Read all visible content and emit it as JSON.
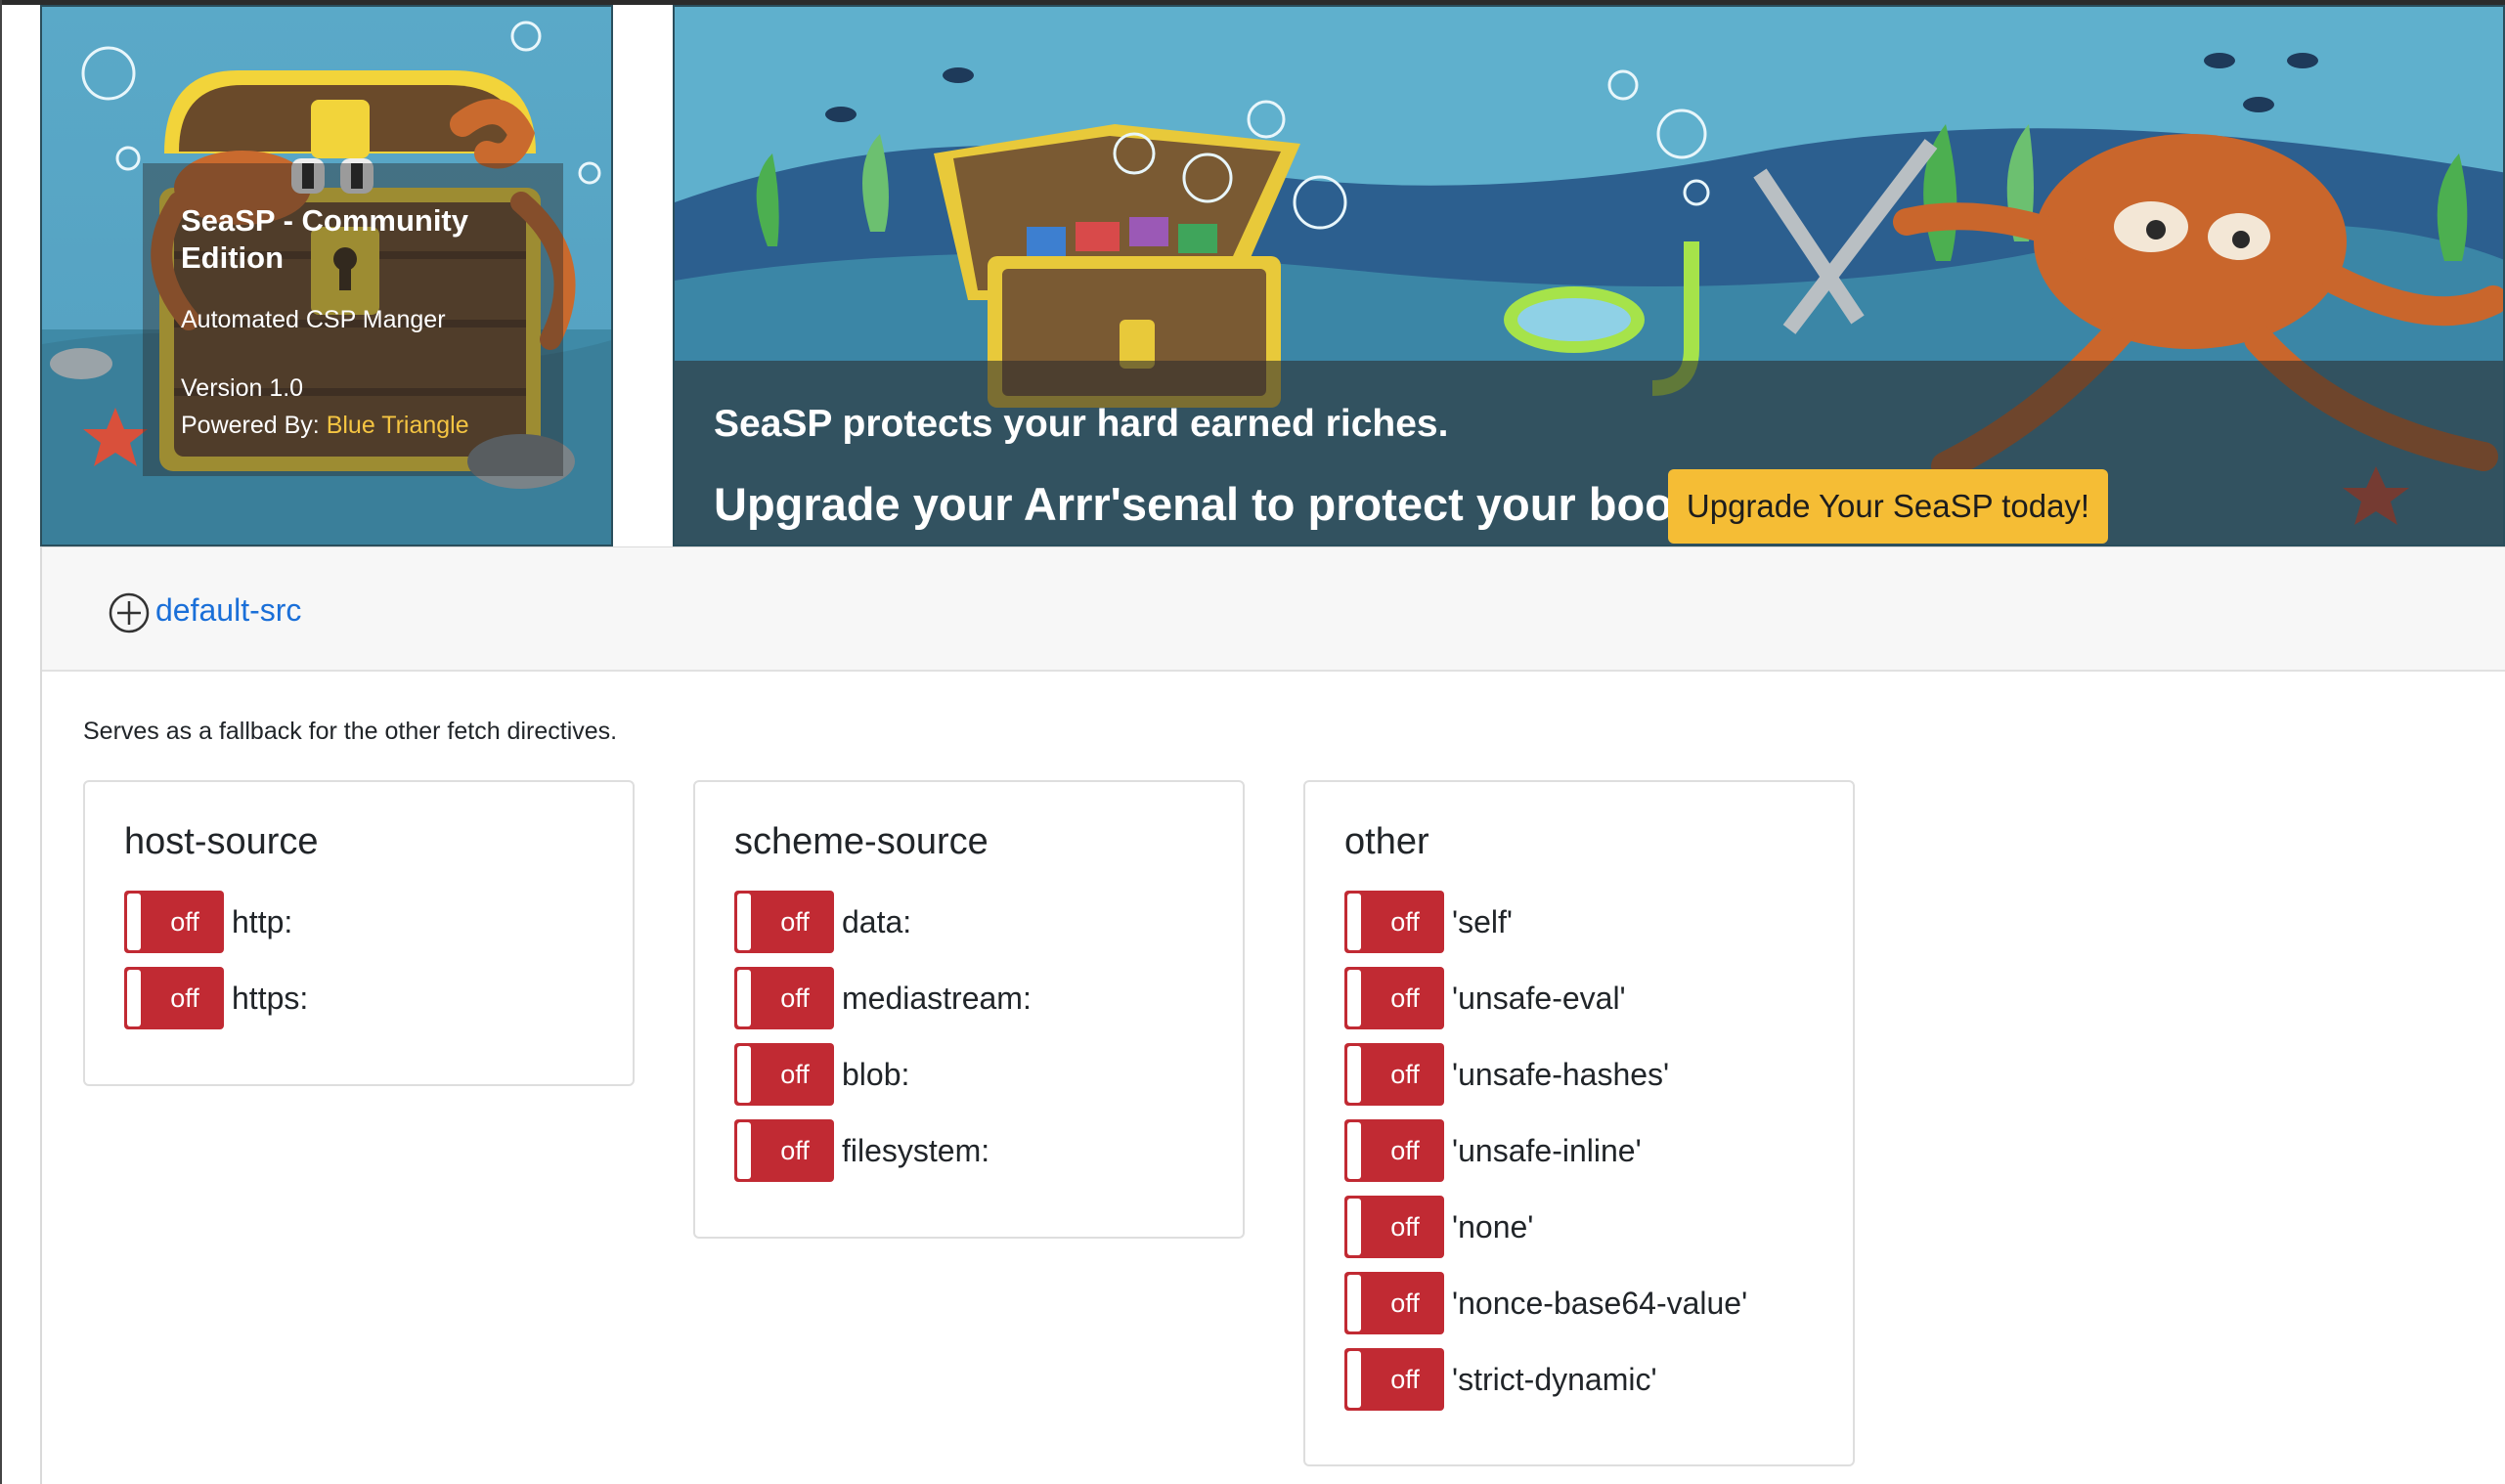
{
  "info_card": {
    "title": "SeaSP - Community Edition",
    "subtitle": "Automated CSP Manger",
    "version": "Version 1.0",
    "powered_by_label": "Powered By:",
    "powered_by_name": "Blue Triangle"
  },
  "banner": {
    "tagline": "SeaSP protects your hard earned riches.",
    "headline": "Upgrade your Arrr'senal to protect your booty!",
    "upgrade_button": "Upgrade Your SeaSP today!"
  },
  "directive": {
    "name": "default-src",
    "description": "Serves as a fallback for the other fetch directives.",
    "groups": [
      {
        "title": "host-source",
        "items": [
          {
            "toggle": "off",
            "label": "http:"
          },
          {
            "toggle": "off",
            "label": "https:"
          }
        ]
      },
      {
        "title": "scheme-source",
        "items": [
          {
            "toggle": "off",
            "label": "data:"
          },
          {
            "toggle": "off",
            "label": "mediastream:"
          },
          {
            "toggle": "off",
            "label": "blob:"
          },
          {
            "toggle": "off",
            "label": "filesystem:"
          }
        ]
      },
      {
        "title": "other",
        "items": [
          {
            "toggle": "off",
            "label": "'self'"
          },
          {
            "toggle": "off",
            "label": "'unsafe-eval'"
          },
          {
            "toggle": "off",
            "label": "'unsafe-hashes'"
          },
          {
            "toggle": "off",
            "label": "'unsafe-inline'"
          },
          {
            "toggle": "off",
            "label": "'none'"
          },
          {
            "toggle": "off",
            "label": "'nonce-base64-value'"
          },
          {
            "toggle": "off",
            "label": "'strict-dynamic'"
          }
        ]
      }
    ]
  },
  "colors": {
    "toggle_off": "#c12a33",
    "link": "#1a6fd8",
    "upgrade_button": "#f5bd35",
    "brand_text": "#f5c542"
  }
}
